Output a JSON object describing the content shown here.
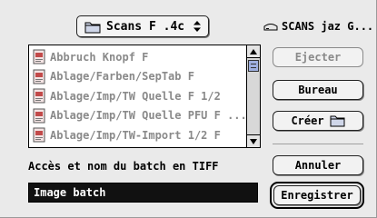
{
  "dialog": {
    "folder_popup": {
      "label": "Scans F .4c",
      "icon": "folder-icon"
    },
    "volume": {
      "label": "SCANS jaz G...",
      "icon": "disk-icon"
    },
    "file_list": {
      "items": [
        {
          "label": "Abbruch Knopf F",
          "icon": "document-icon"
        },
        {
          "label": "Ablage/Farben/SepTab F",
          "icon": "document-icon"
        },
        {
          "label": "Ablage/Imp/TW Quelle F 1/2",
          "icon": "document-icon"
        },
        {
          "label": "Ablage/Imp/TW Quelle PFU F ...",
          "icon": "document-icon"
        },
        {
          "label": "Ablage/Imp/TW-Import 1/2 F",
          "icon": "document-icon"
        }
      ]
    },
    "buttons": {
      "eject": "Ejecter",
      "desktop": "Bureau",
      "create": "Créer",
      "cancel": "Annuler",
      "save": "Enregistrer"
    },
    "prompt": "Accès et nom du batch en TIFF",
    "name_field": {
      "value": "Image batch"
    },
    "colors": {
      "background": "#eaeaea",
      "selection": "#111111",
      "disabled_text": "#8a8a8a",
      "scroll_thumb": "#9fb0e0"
    }
  }
}
